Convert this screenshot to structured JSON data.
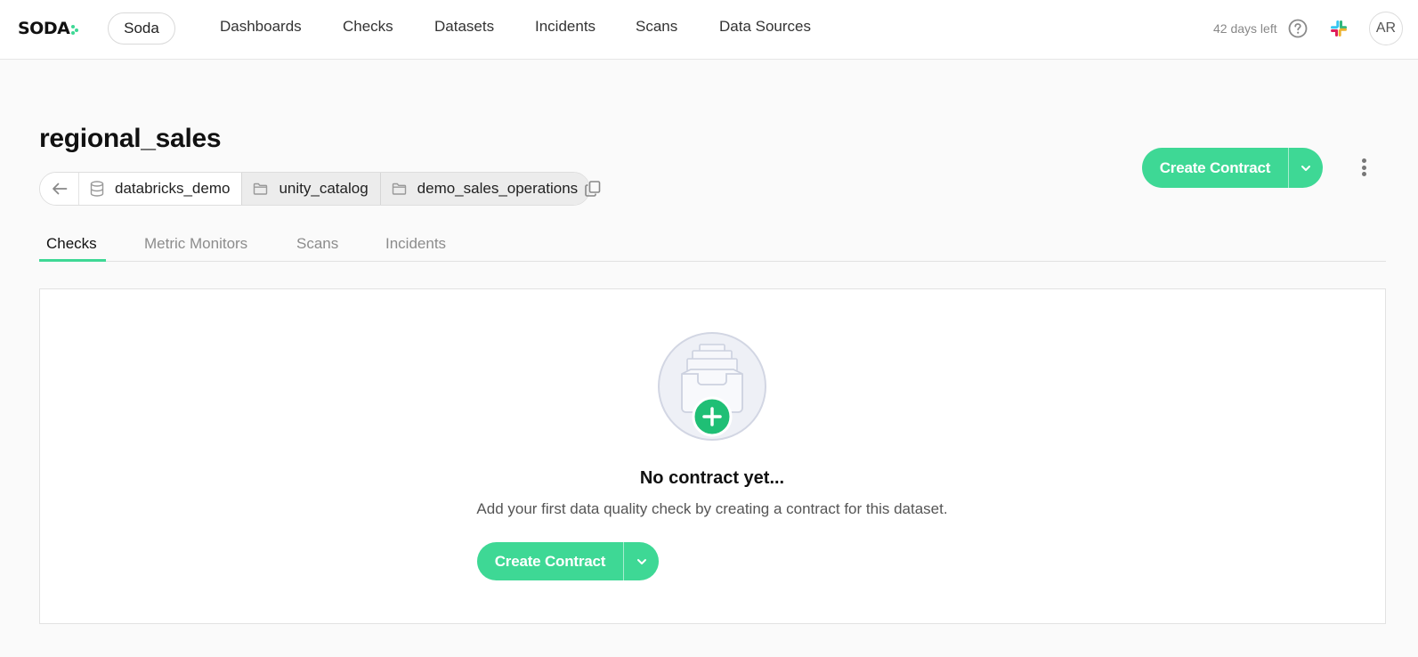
{
  "app": {
    "logo_text": "SODA",
    "organization": "Soda",
    "trial_status": "42 days left",
    "avatar_initials": "AR",
    "accent_color": "#3ed895"
  },
  "nav": {
    "items": [
      {
        "label": "Dashboards"
      },
      {
        "label": "Checks"
      },
      {
        "label": "Datasets"
      },
      {
        "label": "Incidents"
      },
      {
        "label": "Scans"
      },
      {
        "label": "Data Sources"
      }
    ]
  },
  "dataset": {
    "name": "regional_sales",
    "breadcrumb": [
      {
        "label": "databricks_demo",
        "icon": "database-icon"
      },
      {
        "label": "unity_catalog",
        "icon": "folder-icon"
      },
      {
        "label": "demo_sales_operations",
        "icon": "folder-icon"
      }
    ]
  },
  "actions": {
    "create_contract": "Create Contract"
  },
  "tabs": [
    {
      "label": "Checks",
      "active": true
    },
    {
      "label": "Metric Monitors",
      "active": false
    },
    {
      "label": "Scans",
      "active": false
    },
    {
      "label": "Incidents",
      "active": false
    }
  ],
  "empty_state": {
    "title": "No contract yet...",
    "description": "Add your first data quality check by creating a contract for this dataset.",
    "button_label": "Create Contract"
  }
}
